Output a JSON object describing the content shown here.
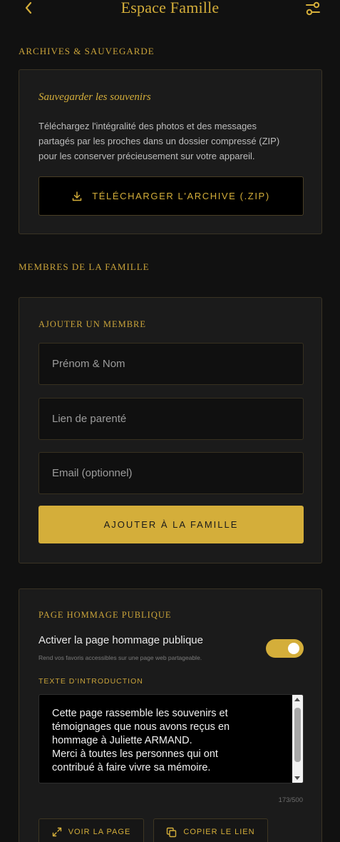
{
  "header": {
    "title": "Espace Famille",
    "back_icon": "chevron-left-icon",
    "settings_icon": "sliders-icon"
  },
  "archives": {
    "section_label": "ARCHIVES & SAUVEGARDE",
    "title": "Sauvegarder les souvenirs",
    "description": "Téléchargez l'intégralité des photos et des messages partagés par les proches dans un dossier compressé (ZIP) pour les conserver précieusement sur votre appareil.",
    "download_label": "TÉLÉCHARGER L'ARCHIVE (.ZIP)",
    "download_icon": "download-icon"
  },
  "members": {
    "section_label": "MEMBRES DE LA FAMILLE",
    "card_title": "AJOUTER UN MEMBRE",
    "name_placeholder": "Prénom & Nom",
    "relation_placeholder": "Lien de parenté",
    "email_placeholder": "Email (optionnel)",
    "add_label": "AJOUTER À LA FAMILLE"
  },
  "public_page": {
    "card_title": "PAGE HOMMAGE PUBLIQUE",
    "toggle_label": "Activer la page hommage publique",
    "toggle_sub": "Rend vos favoris accessibles sur une page web partageable.",
    "toggle_on": true,
    "intro_label": "TEXTE D'INTRODUCTION",
    "intro_text": "Cette page rassemble les souvenirs et\ntémoignages que nous avons reçus en\nhommage à Juliette ARMAND.\nMerci à toutes les personnes qui ont\ncontribué à faire vivre sa mémoire.",
    "char_count": "173/500",
    "view_label": "VOIR LA PAGE",
    "copy_label": "COPIER LE LIEN"
  },
  "colors": {
    "accent": "#d4ae3a",
    "background": "#111111",
    "card": "#1b1b1b"
  }
}
